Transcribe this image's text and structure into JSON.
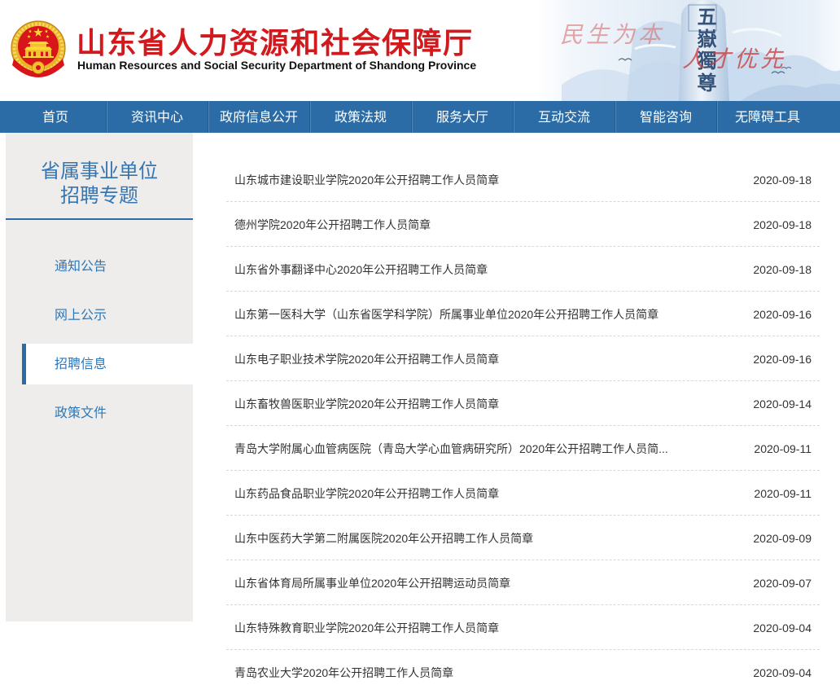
{
  "colors": {
    "brand_red": "#d2191d",
    "nav_blue": "#2b6ca6",
    "accent_blue": "#2e78b7",
    "sidebar_bg": "#eeedeb"
  },
  "header": {
    "title": "山东省人力资源和社会保障厅",
    "subtitle": "Human Resources and Social Security Department of Shandong Province",
    "logo_icon": "national-emblem-icon",
    "banner": {
      "slogan_left": "民生为本",
      "slogan_right": "人才优先",
      "stone_inscription": "五嶽獨尊"
    }
  },
  "nav": {
    "items": [
      "首页",
      "资讯中心",
      "政府信息公开",
      "政策法规",
      "服务大厅",
      "互动交流",
      "智能咨询",
      "无障碍工具"
    ]
  },
  "sidebar": {
    "title_line1": "省属事业单位",
    "title_line2": "招聘专题",
    "items": [
      "通知公告",
      "网上公示",
      "招聘信息",
      "政策文件"
    ],
    "active_index": 2
  },
  "list": {
    "items": [
      {
        "title": "山东城市建设职业学院2020年公开招聘工作人员简章",
        "date": "2020-09-18"
      },
      {
        "title": "德州学院2020年公开招聘工作人员简章",
        "date": "2020-09-18"
      },
      {
        "title": "山东省外事翻译中心2020年公开招聘工作人员简章",
        "date": "2020-09-18"
      },
      {
        "title": "山东第一医科大学（山东省医学科学院）所属事业单位2020年公开招聘工作人员简章",
        "date": "2020-09-16"
      },
      {
        "title": "山东电子职业技术学院2020年公开招聘工作人员简章",
        "date": "2020-09-16"
      },
      {
        "title": "山东畜牧兽医职业学院2020年公开招聘工作人员简章",
        "date": "2020-09-14"
      },
      {
        "title": "青岛大学附属心血管病医院（青岛大学心血管病研究所）2020年公开招聘工作人员简...",
        "date": "2020-09-11"
      },
      {
        "title": "山东药品食品职业学院2020年公开招聘工作人员简章",
        "date": "2020-09-11"
      },
      {
        "title": "山东中医药大学第二附属医院2020年公开招聘工作人员简章",
        "date": "2020-09-09"
      },
      {
        "title": "山东省体育局所属事业单位2020年公开招聘运动员简章",
        "date": "2020-09-07"
      },
      {
        "title": "山东特殊教育职业学院2020年公开招聘工作人员简章",
        "date": "2020-09-04"
      },
      {
        "title": "青岛农业大学2020年公开招聘工作人员简章",
        "date": "2020-09-04"
      }
    ]
  }
}
